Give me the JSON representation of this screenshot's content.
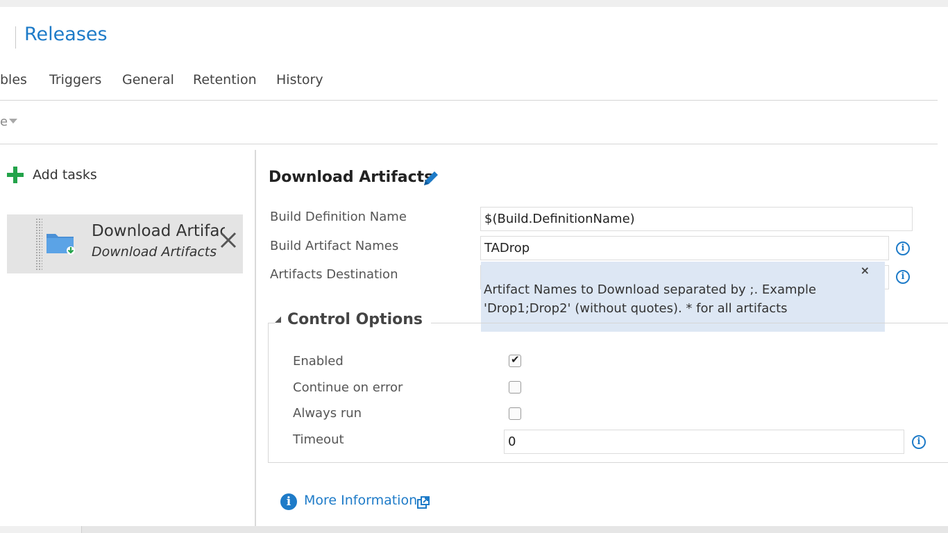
{
  "header": {
    "title": "Releases"
  },
  "tabs": [
    {
      "label": "bles"
    },
    {
      "label": "Triggers"
    },
    {
      "label": "General"
    },
    {
      "label": "Retention"
    },
    {
      "label": "History"
    }
  ],
  "toolbar": {
    "fragment": "e"
  },
  "tasks_pane": {
    "add_tasks_label": "Add tasks",
    "task": {
      "title": "Download Artifacts",
      "subtitle": "Download Artifacts",
      "icon": "folder-download-icon"
    }
  },
  "details": {
    "title": "Download Artifacts",
    "fields": [
      {
        "label": "Build Definition Name",
        "value": "$(Build.DefinitionName)"
      },
      {
        "label": "Build Artifact Names",
        "value": "TADrop"
      },
      {
        "label": "Artifacts Destination",
        "value": ""
      }
    ],
    "tooltip": {
      "text": "Artifact Names to Download separated by ;. Example 'Drop1;Drop2' (without quotes). * for all artifacts",
      "close": "×"
    },
    "control_options": {
      "title": "Control Options",
      "enabled_label": "Enabled",
      "enabled": true,
      "continue_on_error_label": "Continue on error",
      "continue_on_error": false,
      "always_run_label": "Always run",
      "always_run": false,
      "timeout_label": "Timeout",
      "timeout_value": "0"
    },
    "more_information_label": "More Information"
  },
  "colors": {
    "accent": "#1e7bc8",
    "add_green": "#23a34a",
    "tooltip_bg": "#dde7f4",
    "card_bg": "#e4e4e4"
  }
}
